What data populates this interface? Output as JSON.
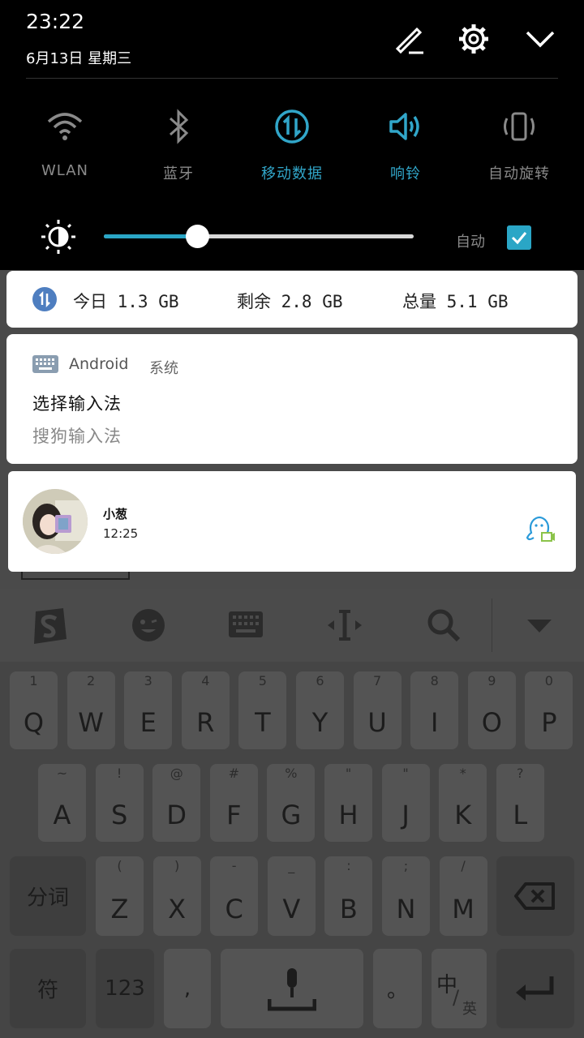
{
  "status": {
    "time": "23:22",
    "date": "6月13日 星期三"
  },
  "quick_settings": [
    {
      "label": "WLAN",
      "active": false,
      "icon": "wifi-icon"
    },
    {
      "label": "蓝牙",
      "active": false,
      "icon": "bluetooth-icon"
    },
    {
      "label": "移动数据",
      "active": true,
      "icon": "mobile-data-icon"
    },
    {
      "label": "响铃",
      "active": true,
      "icon": "ring-icon"
    },
    {
      "label": "自动旋转",
      "active": false,
      "icon": "rotate-icon"
    }
  ],
  "brightness": {
    "level": 0.3,
    "auto_label": "自动",
    "auto_checked": true
  },
  "data_usage": {
    "today": "今日 1.3 GB",
    "remaining": "剩余 2.8 GB",
    "total": "总量 5.1 GB"
  },
  "ime_notification": {
    "app": "Android",
    "app_sub": "系统",
    "title": "选择输入法",
    "subtitle": "搜狗输入法"
  },
  "qq_notification": {
    "name": "小葱",
    "time": "12:25"
  },
  "keyboard": {
    "row1": [
      {
        "sub": "1",
        "main": "Q"
      },
      {
        "sub": "2",
        "main": "W"
      },
      {
        "sub": "3",
        "main": "E"
      },
      {
        "sub": "4",
        "main": "R"
      },
      {
        "sub": "5",
        "main": "T"
      },
      {
        "sub": "6",
        "main": "Y"
      },
      {
        "sub": "7",
        "main": "U"
      },
      {
        "sub": "8",
        "main": "I"
      },
      {
        "sub": "9",
        "main": "O"
      },
      {
        "sub": "0",
        "main": "P"
      }
    ],
    "row2": [
      {
        "sub": "~",
        "main": "A"
      },
      {
        "sub": "!",
        "main": "S"
      },
      {
        "sub": "@",
        "main": "D"
      },
      {
        "sub": "#",
        "main": "F"
      },
      {
        "sub": "%",
        "main": "G"
      },
      {
        "sub": "\"",
        "main": "H"
      },
      {
        "sub": "\"",
        "main": "J"
      },
      {
        "sub": "*",
        "main": "K"
      },
      {
        "sub": "?",
        "main": "L"
      }
    ],
    "row3": [
      {
        "sub": "(",
        "main": "Z"
      },
      {
        "sub": ")",
        "main": "X"
      },
      {
        "sub": "-",
        "main": "C"
      },
      {
        "sub": "_",
        "main": "V"
      },
      {
        "sub": ":",
        "main": "B"
      },
      {
        "sub": ";",
        "main": "N"
      },
      {
        "sub": "/",
        "main": "M"
      }
    ],
    "segment_label": "分词",
    "symbol_label": "符",
    "num_label": "123",
    "comma_label": ",",
    "period_label": "。",
    "lang_main": "中",
    "lang_sub": "英"
  }
}
